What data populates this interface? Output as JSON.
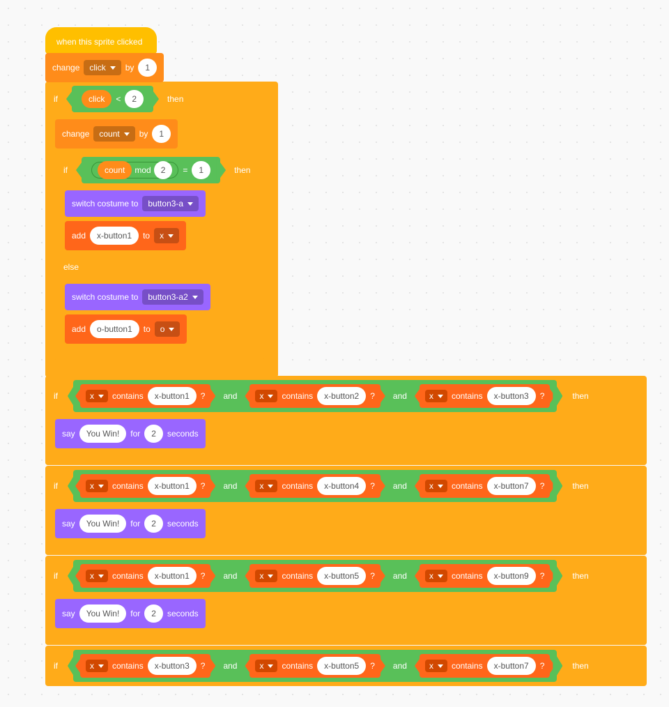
{
  "hat": {
    "label": "when this sprite clicked"
  },
  "change1": {
    "prefix": "change",
    "var": "click",
    "mid": "by",
    "val": "1"
  },
  "if1": {
    "kw_if": "if",
    "kw_then": "then",
    "lt": {
      "left": "click",
      "op": "<",
      "right": "2"
    }
  },
  "change2": {
    "prefix": "change",
    "var": "count",
    "mid": "by",
    "val": "1"
  },
  "if2": {
    "kw_if": "if",
    "kw_then": "then",
    "kw_else": "else",
    "eq": {
      "mod_var": "count",
      "mod_kw": "mod",
      "mod_val": "2",
      "op": "=",
      "right": "1"
    }
  },
  "switch1": {
    "prefix": "switch costume to",
    "val": "button3-a"
  },
  "add1": {
    "prefix": "add",
    "val": "x-button1",
    "mid": "to",
    "list": "x"
  },
  "switch2": {
    "prefix": "switch costume to",
    "val": "button3-a2"
  },
  "add2": {
    "prefix": "add",
    "val": "o-button1",
    "mid": "to",
    "list": "o"
  },
  "rows": [
    {
      "items": [
        "x-button1",
        "x-button2",
        "x-button3"
      ]
    },
    {
      "items": [
        "x-button1",
        "x-button4",
        "x-button7"
      ]
    },
    {
      "items": [
        "x-button1",
        "x-button5",
        "x-button9"
      ]
    },
    {
      "items": [
        "x-button3",
        "x-button5",
        "x-button7"
      ]
    }
  ],
  "contains": {
    "list": "x",
    "kw": "contains",
    "q": "?",
    "and": "and"
  },
  "say": {
    "prefix": "say",
    "msg": "You Win!",
    "mid": "for",
    "sec": "2",
    "suffix": "seconds"
  },
  "kw": {
    "if": "if",
    "then": "then"
  }
}
